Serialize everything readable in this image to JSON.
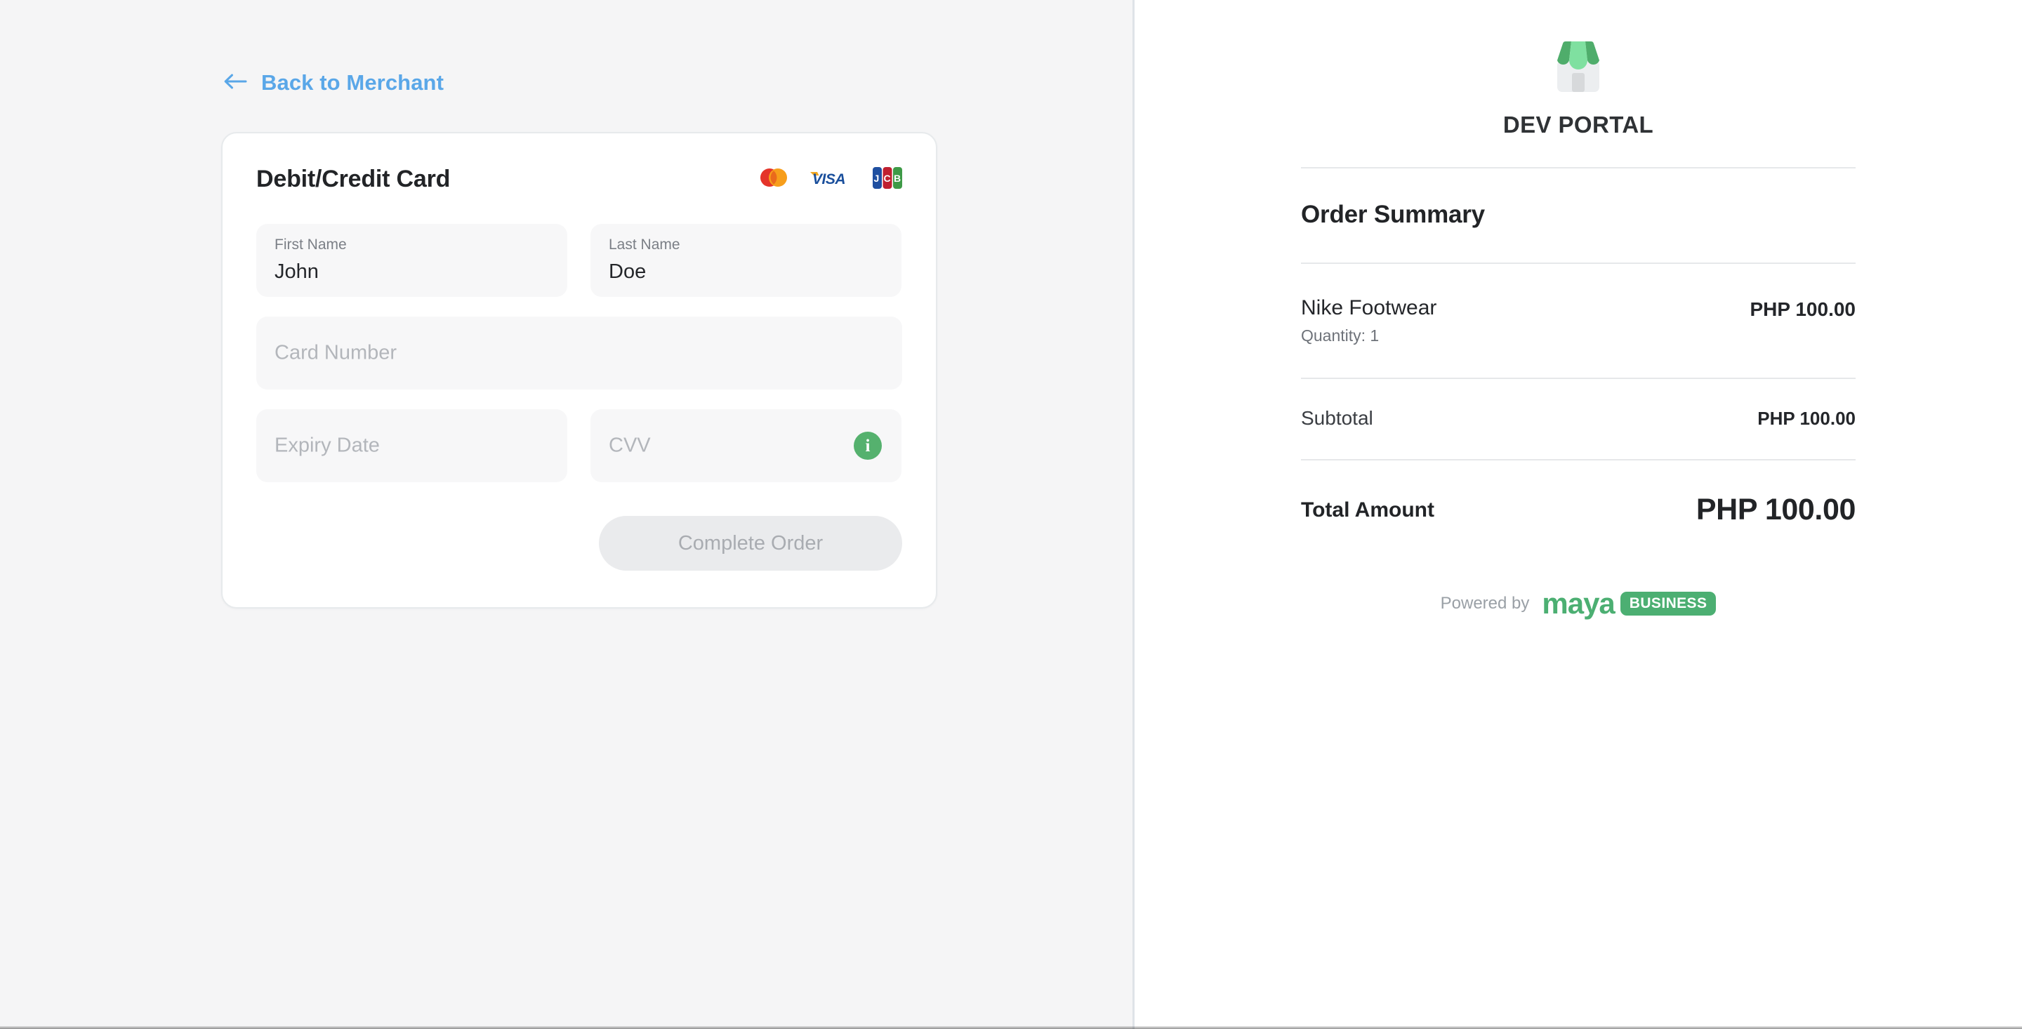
{
  "left": {
    "back_link": {
      "label": "Back to Merchant",
      "icon": "arrow-left-icon",
      "color": "#5aa7e8"
    },
    "payment_card": {
      "title": "Debit/Credit Card",
      "brands": [
        "mastercard-logo",
        "visa-logo",
        "jcb-logo"
      ],
      "fields": {
        "first_name": {
          "label": "First Name",
          "value": "John",
          "placeholder": "First Name"
        },
        "last_name": {
          "label": "Last Name",
          "value": "Doe",
          "placeholder": "Last Name"
        },
        "card_number": {
          "label": "Card Number",
          "value": "",
          "placeholder": "Card Number"
        },
        "expiry_date": {
          "label": "Expiry Date",
          "value": "",
          "placeholder": "Expiry Date"
        },
        "cvv": {
          "label": "CVV",
          "value": "",
          "placeholder": "CVV",
          "info_icon": "info-icon"
        }
      },
      "submit": {
        "label": "Complete Order",
        "disabled": true
      }
    }
  },
  "right": {
    "merchant": {
      "name": "DEV PORTAL",
      "logo": "storefront-icon"
    },
    "summary": {
      "title": "Order Summary",
      "items": [
        {
          "name": "Nike Footwear",
          "quantity_label": "Quantity: 1",
          "price": "PHP 100.00"
        }
      ],
      "subtotal": {
        "label": "Subtotal",
        "value": "PHP 100.00"
      },
      "total": {
        "label": "Total Amount",
        "value": "PHP 100.00"
      }
    },
    "footer": {
      "powered_by": "Powered by",
      "brand": "maya",
      "brand_badge": "BUSINESS"
    }
  },
  "colors": {
    "link_blue": "#5aa7e8",
    "accent_green": "#4caf72",
    "info_green": "#55b16e",
    "page_bg_left": "#f5f5f6",
    "page_bg_right": "#ffffff",
    "field_bg": "#f7f7f8",
    "disabled_btn_bg": "#eaebed"
  }
}
